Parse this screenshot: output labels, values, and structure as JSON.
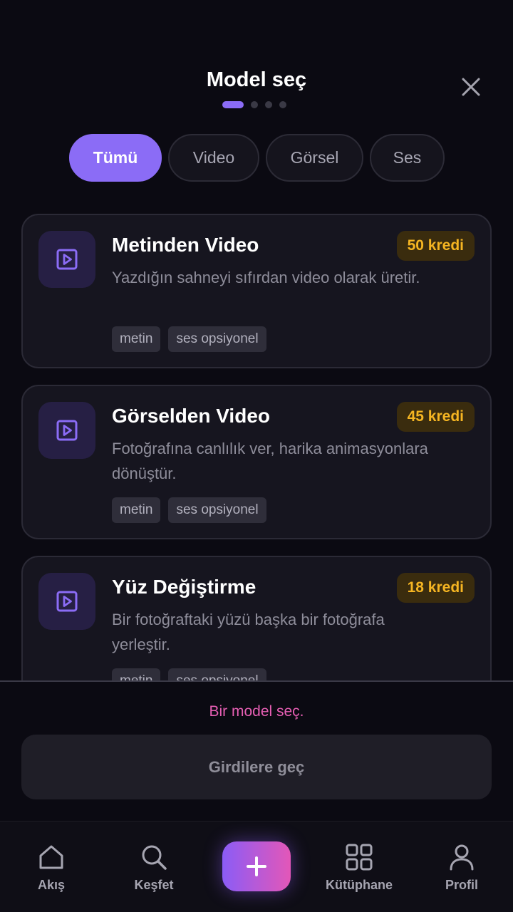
{
  "header": {
    "title": "Model seç",
    "steps": {
      "total": 4,
      "current": 1
    }
  },
  "filters": [
    {
      "label": "Tümü",
      "active": true
    },
    {
      "label": "Video",
      "active": false
    },
    {
      "label": "Görsel",
      "active": false
    },
    {
      "label": "Ses",
      "active": false
    }
  ],
  "models": [
    {
      "title": "Metinden Video",
      "credits": "50 kredi",
      "description": "Yazdığın sahneyi sıfırdan video olarak üretir.",
      "tags": [
        "metin",
        "ses opsiyonel"
      ],
      "icon": "video-play-icon"
    },
    {
      "title": "Görselden Video",
      "credits": "45 kredi",
      "description": "Fotoğrafına canlılık ver, harika animasyonlara dönüştür.",
      "tags": [
        "metin",
        "ses opsiyonel"
      ],
      "icon": "video-play-icon"
    },
    {
      "title": "Yüz Değiştirme",
      "credits": "18 kredi",
      "description": "Bir fotoğraftaki yüzü başka bir fotoğrafa yerleştir.",
      "tags": [
        "metin",
        "ses opsiyonel"
      ],
      "icon": "video-play-icon"
    }
  ],
  "footer": {
    "hint": "Bir model seç.",
    "cta_label": "Girdilere geç"
  },
  "nav": [
    {
      "label": "Akış",
      "icon": "home-icon"
    },
    {
      "label": "Keşfet",
      "icon": "search-icon"
    },
    {
      "label": "Kütüphane",
      "icon": "grid-icon"
    },
    {
      "label": "Profil",
      "icon": "user-icon"
    }
  ],
  "colors": {
    "accent": "#8b6cf6",
    "badge_text": "#f5b522",
    "hint_pink": "#e75fb4",
    "background": "#0b0a12"
  }
}
